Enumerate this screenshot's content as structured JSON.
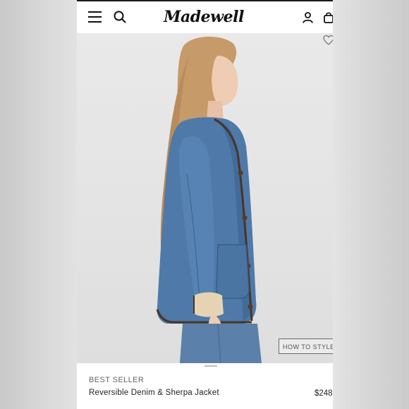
{
  "brand": {
    "logo_text": "Madewell"
  },
  "header": {
    "icons": [
      "hamburger-menu-icon",
      "search-icon",
      "account-icon",
      "shopping-bag-icon"
    ]
  },
  "hero": {
    "wishlist_icon": "heart-icon",
    "how_to_style_label": "HOW TO STYLE IT"
  },
  "product": {
    "badge": "BEST SELLER",
    "name": "Reversible Denim & Sherpa Jacket",
    "price": "$248"
  },
  "colors": {
    "background_blur": "#d3d3d3",
    "page": "#ffffff",
    "denim": "#4f79a8",
    "sherpa": "#e6d3b4",
    "text": "#222222"
  }
}
